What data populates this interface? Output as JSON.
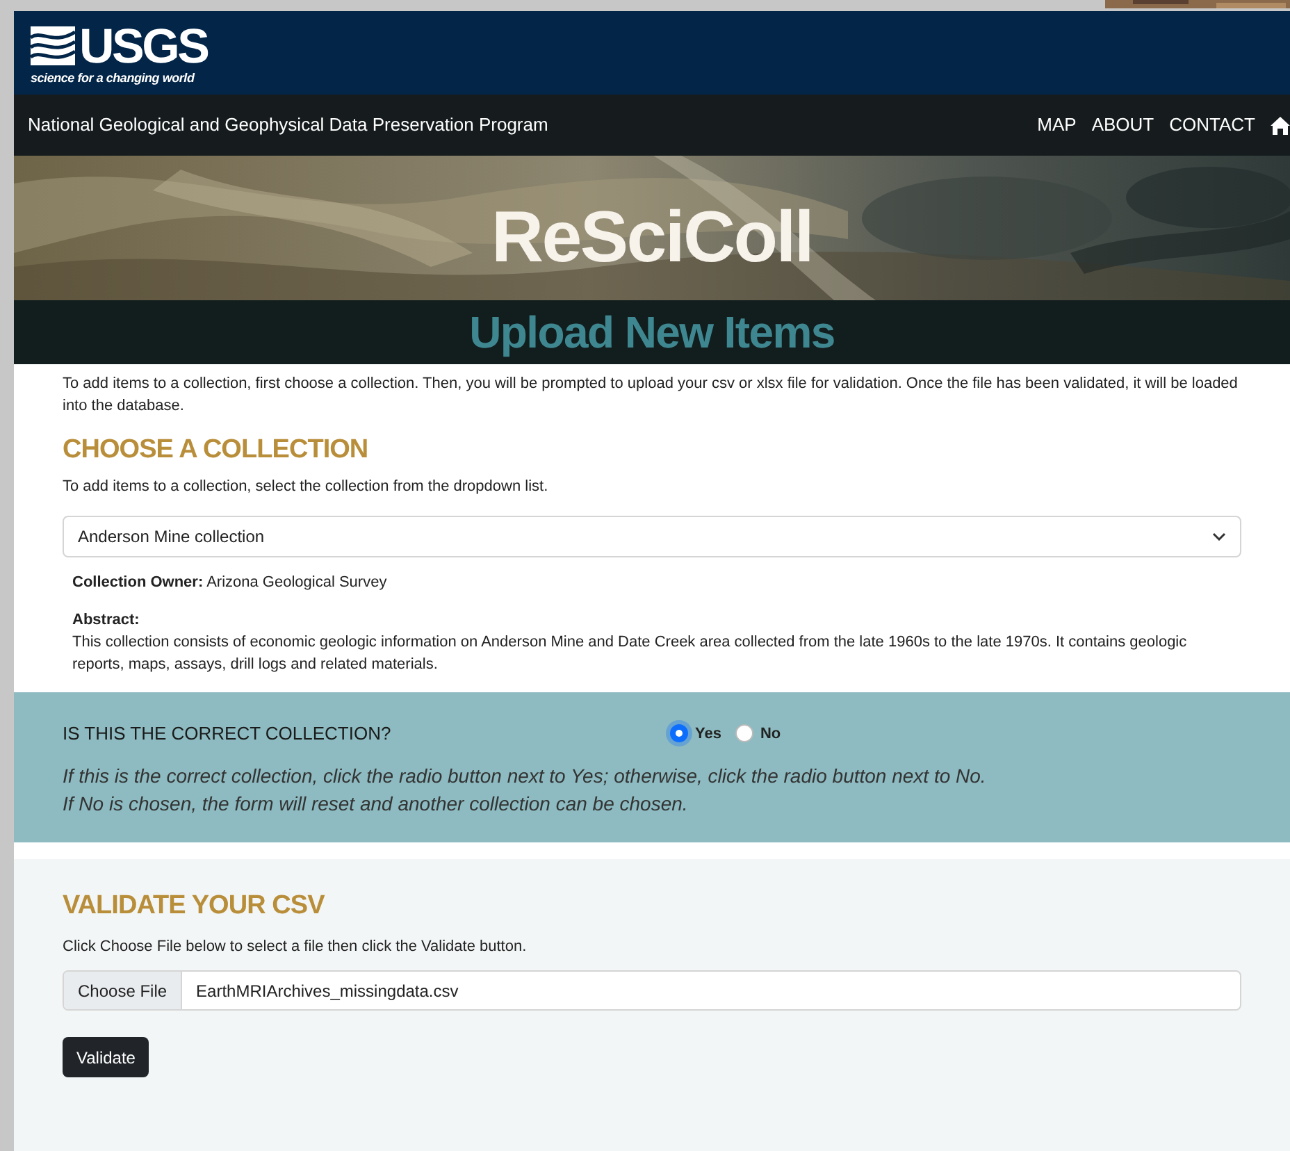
{
  "logo": {
    "wordmark": "USGS",
    "tagline": "science for a changing world"
  },
  "nav_bar": {
    "program_title": "National Geological and Geophysical Data Preservation Program",
    "links": [
      "MAP",
      "ABOUT",
      "CONTACT"
    ]
  },
  "banner": {
    "title": "ReSciColl",
    "subtitle": "Upload New Items"
  },
  "intro": "To add items to a collection, first choose a collection. Then, you will be prompted to upload your csv or xlsx file for validation. Once the file has been validated, it will be loaded into the database.",
  "choose_collection": {
    "heading": "CHOOSE A COLLECTION",
    "instructions": "To add items to a collection, select the collection from the dropdown list.",
    "selected_value": "Anderson Mine collection",
    "owner_label": "Collection Owner:",
    "owner": "Arizona Geological Survey",
    "abstract_label": "Abstract:",
    "abstract": "This collection consists of economic geologic information on Anderson Mine and Date Creek area collected from the late 1960s to the late 1970s. It contains geologic reports, maps, assays, drill logs and related materials."
  },
  "confirm": {
    "question": "IS THIS THE CORRECT COLLECTION?",
    "options": [
      {
        "label": "Yes",
        "selected": true
      },
      {
        "label": "No",
        "selected": false
      }
    ],
    "help_lines": [
      "If this is the correct collection, click the radio button next to Yes; otherwise, click the radio button next to No.",
      "If No is chosen, the form will reset and another collection can be chosen."
    ]
  },
  "validate": {
    "heading": "VALIDATE YOUR CSV",
    "instructions": "Click Choose File below to select a file then click the Validate button.",
    "choose_file_button": "Choose File",
    "file_name": "EarthMRIArchives_missingdata.csv",
    "validate_button": "Validate"
  }
}
